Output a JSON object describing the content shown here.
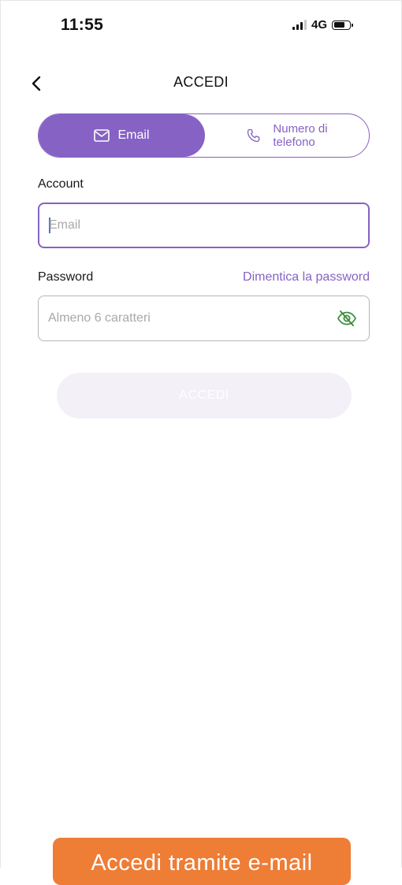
{
  "status_bar": {
    "time": "11:55",
    "network": "4G"
  },
  "nav": {
    "title": "ACCEDI"
  },
  "tabs": {
    "email_label": "Email",
    "phone_label_line1": "Numero di",
    "phone_label_line2": "telefono",
    "active": "email"
  },
  "form": {
    "account_label": "Account",
    "account_placeholder": "Email",
    "account_value": "",
    "password_label": "Password",
    "forgot_link": "Dimentica la password",
    "password_placeholder": "Almeno 6 caratteri",
    "password_value": "",
    "submit_label": "ACCEDI"
  },
  "banner": {
    "label": "Accedi tramite e-mail"
  },
  "icons": {
    "back": "chevron-left-icon",
    "email": "envelope-icon",
    "phone": "phone-icon",
    "visibility": "eye-off-icon"
  },
  "colors": {
    "accent": "#8662c4",
    "eye_icon": "#3a8f3c",
    "banner": "#ee7d36",
    "submit_disabled_bg": "#f3f0f8"
  }
}
